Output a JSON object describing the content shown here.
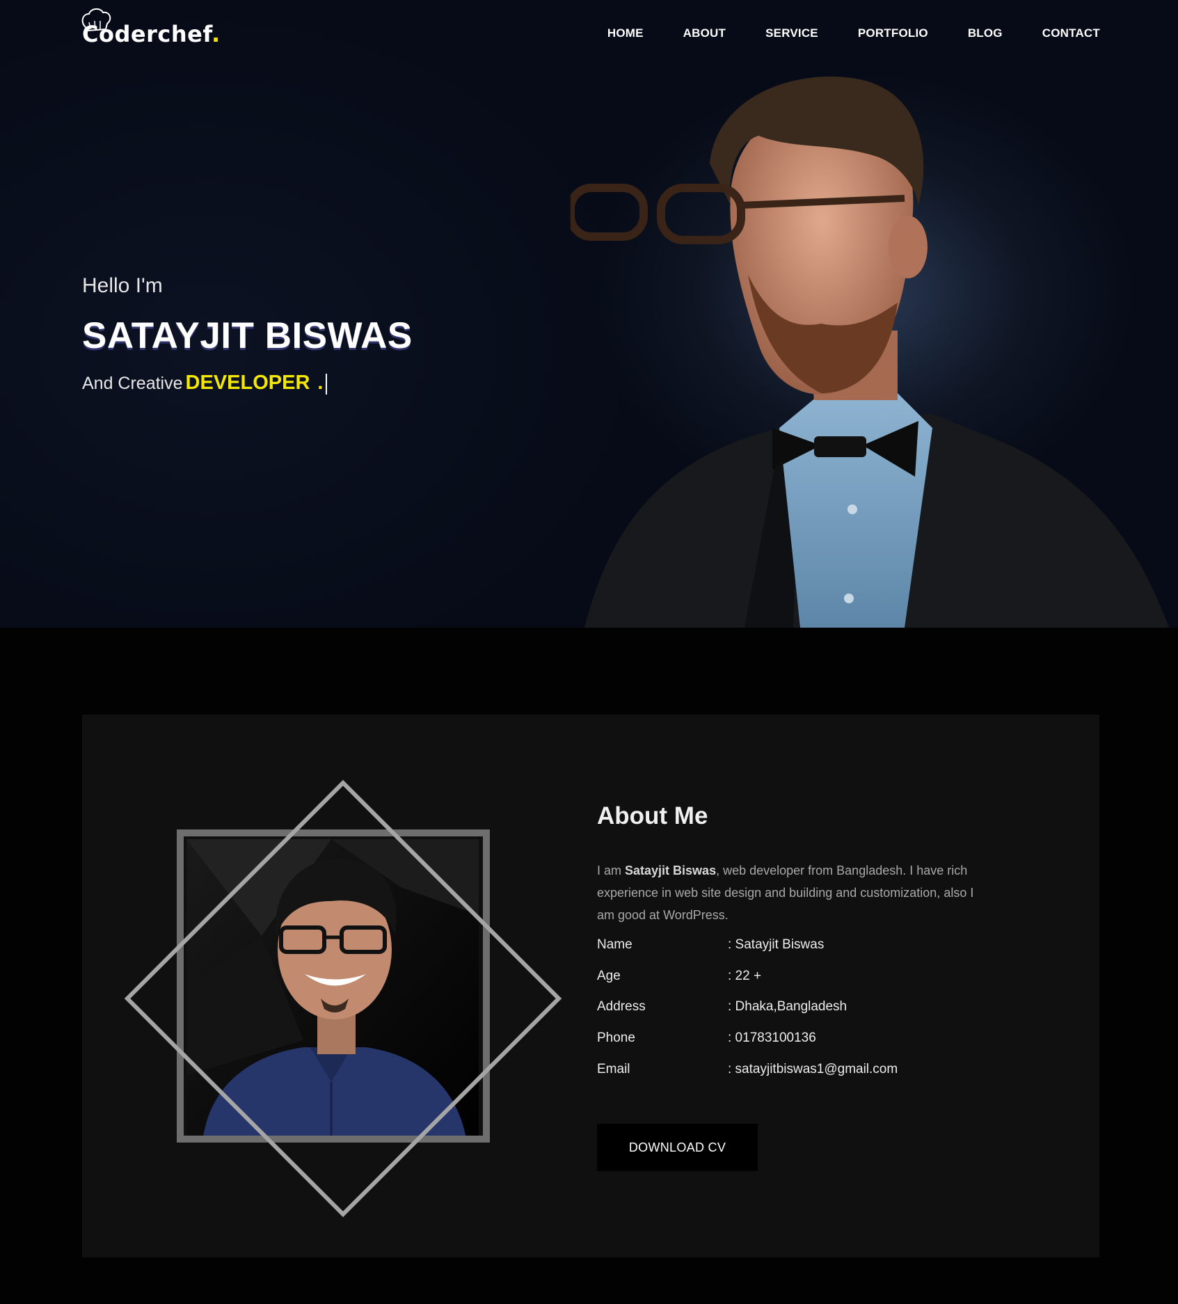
{
  "brand": {
    "name": "Coderchef",
    "dot": "."
  },
  "nav": {
    "items": [
      {
        "label": "HOME"
      },
      {
        "label": "ABOUT"
      },
      {
        "label": "SERVICE"
      },
      {
        "label": "PORTFOLIO"
      },
      {
        "label": "BLOG"
      },
      {
        "label": "CONTACT"
      }
    ]
  },
  "hero": {
    "greeting": "Hello I'm",
    "name": "SATAYJIT BISWAS",
    "tagline_prefix": "And Creative",
    "role": "DEVELOPER",
    "role_suffix": "."
  },
  "about": {
    "heading": "About Me",
    "bio_prefix": "I am ",
    "bio_name": "Satayjit Biswas",
    "bio_rest": ", web developer from Bangladesh. I have rich experience in web site design and building and customization, also I am good at WordPress.",
    "details": [
      {
        "label": "Name",
        "value": ": Satayjit Biswas"
      },
      {
        "label": "Age",
        "value": ": 22 +"
      },
      {
        "label": "Address",
        "value": ": Dhaka,Bangladesh"
      },
      {
        "label": "Phone",
        "value": ": 01783100136"
      },
      {
        "label": "Email",
        "value": ": satayjitbiswas1@gmail.com"
      }
    ],
    "button_label": "DOWNLOAD CV"
  },
  "colors": {
    "accent": "#f5e800",
    "hero_bg": "#060a16",
    "card_bg": "#101010"
  }
}
